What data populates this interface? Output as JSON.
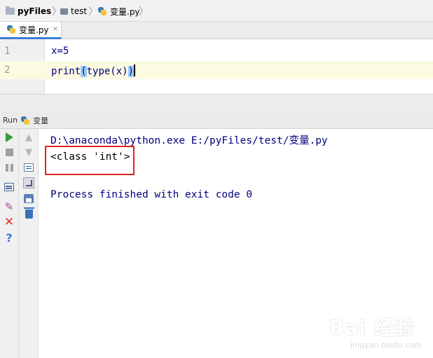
{
  "breadcrumb": {
    "project": "pyFiles",
    "folder": "test",
    "file": "变量.py"
  },
  "tab": {
    "active_label": "变量.py",
    "close_symbol": "×"
  },
  "editor": {
    "lines": [
      {
        "num": "1",
        "code": "x=5"
      },
      {
        "num": "2",
        "code_before": "print",
        "paren_open": "(",
        "code_middle": "type(x)",
        "paren_close": ")"
      }
    ]
  },
  "run_panel": {
    "label": "Run",
    "config_name": "变量"
  },
  "console": {
    "command": "D:\\anaconda\\python.exe E:/pyFiles/test/变量.py",
    "output": "<class 'int'>",
    "finish": "Process finished with exit code 0"
  },
  "watermark": {
    "logo": "Bai 经验",
    "sub": "jingyan.baidu.com"
  },
  "colors": {
    "accent": "#3d7bd9",
    "console_text": "#00007f",
    "highlight_box": "#e02424",
    "current_line": "#fcfae1"
  }
}
